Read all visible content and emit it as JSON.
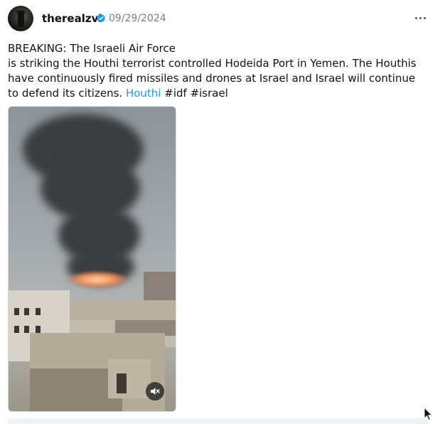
{
  "post": {
    "author": {
      "username": "therealzvi",
      "verified": true
    },
    "date": "09/29/2024",
    "text_line1": "BREAKING: The Israeli Air Force",
    "text_line2": "is striking the Houthi terrorist controlled Hodeida Port in Yemen. The Houthis have continuously fired missiles and drones at Israel and Israel will continue to defend its citizens.",
    "link_text": "Houthi",
    "hashtags": "#idf #israel",
    "media": {
      "type": "video",
      "muted": true
    }
  },
  "colors": {
    "link": "#1d9bf0",
    "verified": "#1d9bf0",
    "date": "#7a8085"
  },
  "icons": {
    "verified": "verified-badge-icon",
    "more": "more-options-icon",
    "mute": "muted-speaker-icon",
    "cursor": "mouse-cursor-icon"
  }
}
